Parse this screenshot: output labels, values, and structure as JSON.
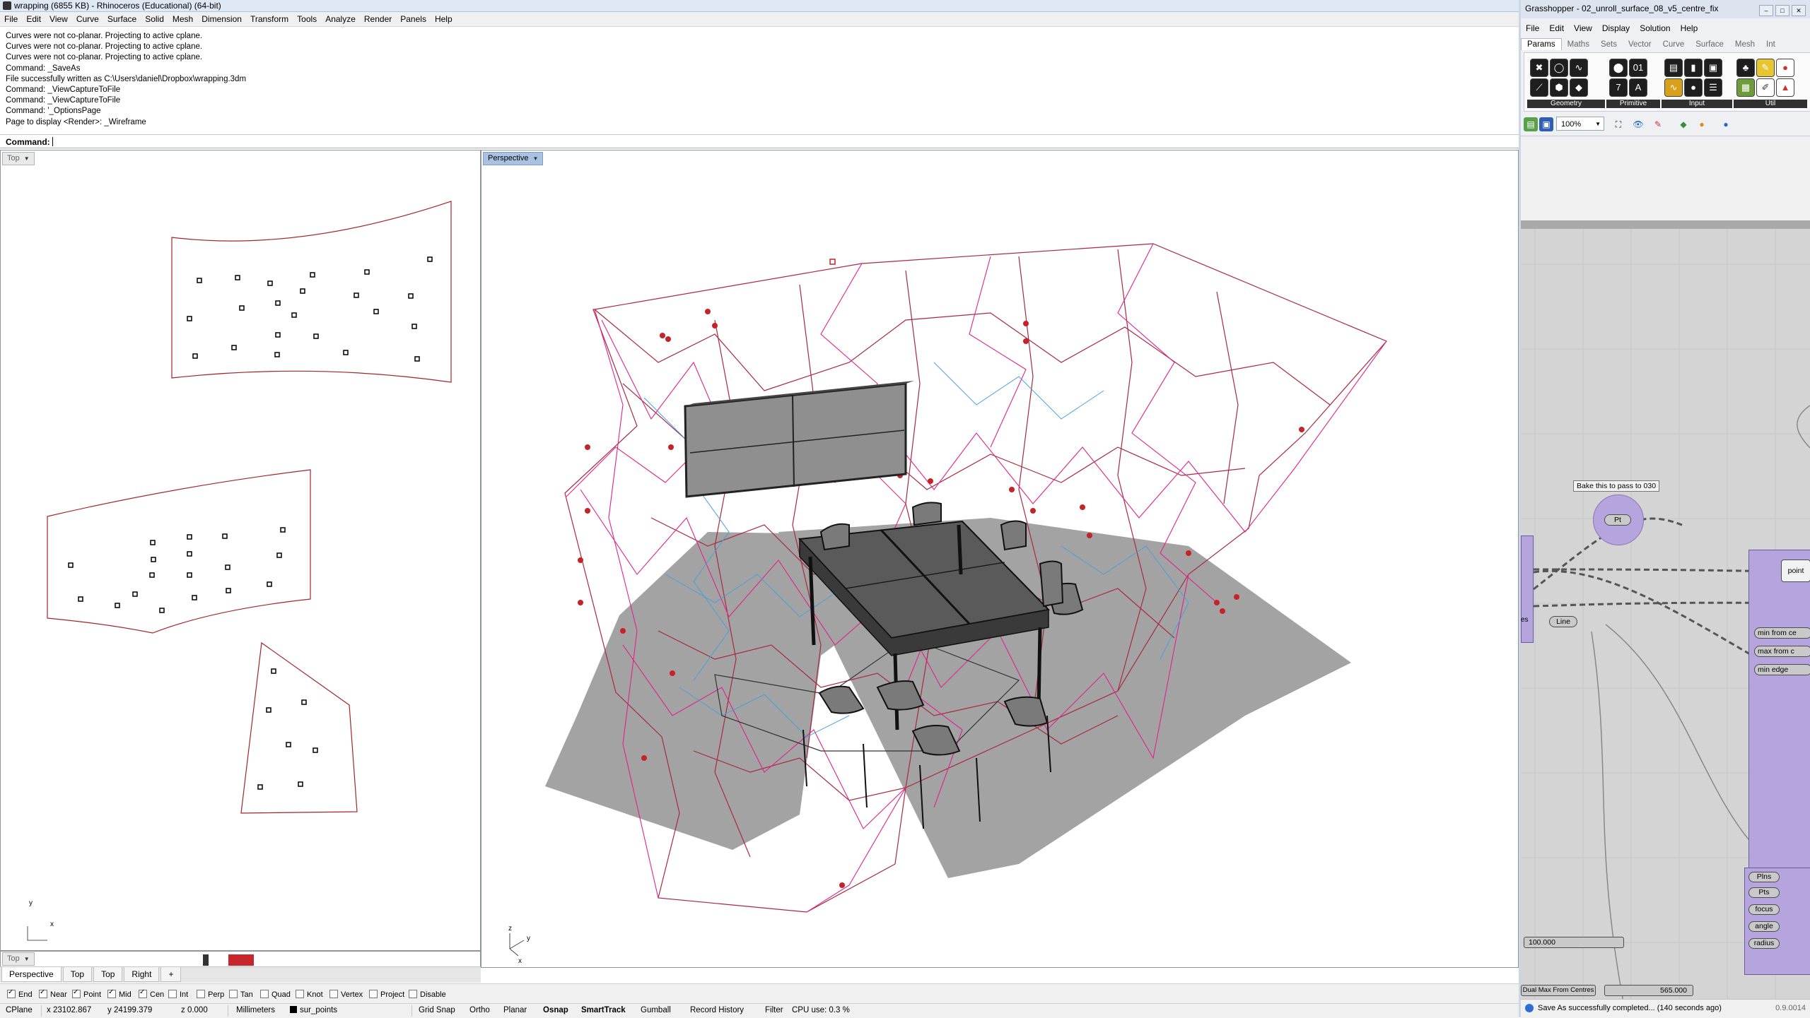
{
  "rhino": {
    "title": "wrapping (6855 KB) - Rhinoceros (Educational) (64-bit)",
    "menu": [
      "File",
      "Edit",
      "View",
      "Curve",
      "Surface",
      "Solid",
      "Mesh",
      "Dimension",
      "Transform",
      "Tools",
      "Analyze",
      "Render",
      "Panels",
      "Help"
    ],
    "history": [
      "Curves were not co-planar. Projecting to active cplane.",
      "Curves were not co-planar. Projecting to active cplane.",
      "Curves were not co-planar. Projecting to active cplane.",
      "Command: _SaveAs",
      "File successfully written as C:\\Users\\daniel\\Dropbox\\wrapping.3dm",
      "Command: _ViewCaptureToFile",
      "Command: _ViewCaptureToFile",
      "Command: '_OptionsPage",
      "Page to display <Render>: _Wireframe"
    ],
    "command_label": "Command:",
    "viewports": {
      "top_label": "Top",
      "perspective_label": "Perspective",
      "small_label": "Top",
      "axis_x": "x",
      "axis_y": "y",
      "axis_z": "z"
    },
    "viewport_tabs": [
      "Perspective",
      "Top",
      "Top",
      "Right"
    ],
    "osnap": [
      "End",
      "Near",
      "Point",
      "Mid",
      "Cen",
      "Int",
      "Perp",
      "Tan",
      "Quad",
      "Knot",
      "Vertex",
      "Project",
      "Disable"
    ],
    "osnap_checked": [
      true,
      true,
      true,
      true,
      true,
      false,
      false,
      false,
      false,
      false,
      false,
      false,
      false
    ],
    "status": {
      "cplane": "CPlane",
      "x": "x 23102.867",
      "y": "y 24199.379",
      "z": "z 0.000",
      "units": "Millimeters",
      "layer": "sur_points",
      "grid_snap": "Grid Snap",
      "ortho": "Ortho",
      "planar": "Planar",
      "osnap": "Osnap",
      "smarttrack": "SmartTrack",
      "gumball": "Gumball",
      "record_history": "Record History",
      "filter": "Filter",
      "cpu": "CPU use: 0.3 %"
    }
  },
  "grasshopper": {
    "title": "Grasshopper - 02_unroll_surface_08_v5_centre_fix",
    "menu": [
      "File",
      "Edit",
      "View",
      "Display",
      "Solution",
      "Help"
    ],
    "tabs": [
      "Params",
      "Maths",
      "Sets",
      "Vector",
      "Curve",
      "Surface",
      "Mesh",
      "Int"
    ],
    "groups": [
      "Geometry",
      "Primitive",
      "Input",
      "Util"
    ],
    "zoom": "100%",
    "nodes": {
      "bake_note": "Bake this to pass to 030",
      "pt": "Pt",
      "point": "point",
      "line": "Line",
      "es": "es",
      "min_from": "min from ce",
      "max_from": "max from c",
      "min_edge": "min edge",
      "plns": "Plns",
      "pts": "Pts",
      "focus": "focus",
      "angle": "angle",
      "radius": "radius",
      "slider1": "100.000",
      "slider2_label": "Dual Max From Centres",
      "slider2": "565.000"
    },
    "status": "Save As successfully completed... (140 seconds ago)",
    "version": "0.9.0014"
  }
}
